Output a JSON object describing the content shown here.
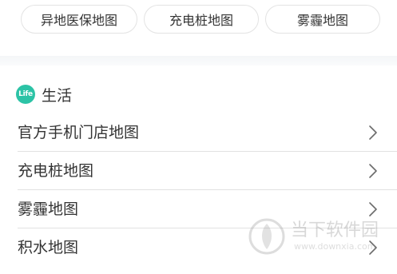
{
  "top_chips": [
    {
      "label": "异地医保地图"
    },
    {
      "label": "充电桩地图"
    },
    {
      "label": "雾霾地图"
    }
  ],
  "section": {
    "badge_text": "Life",
    "badge_color": "#2cc3a6",
    "title": "生活"
  },
  "list_items": [
    {
      "label": "官方手机门店地图",
      "icon": "chevron-right-icon"
    },
    {
      "label": "充电桩地图",
      "icon": "chevron-right-icon"
    },
    {
      "label": "雾霾地图",
      "icon": "chevron-right-icon"
    },
    {
      "label": "积水地图",
      "icon": "chevron-right-icon"
    }
  ],
  "watermark": {
    "text": "当下软件园",
    "url": "www.downxia.com"
  }
}
